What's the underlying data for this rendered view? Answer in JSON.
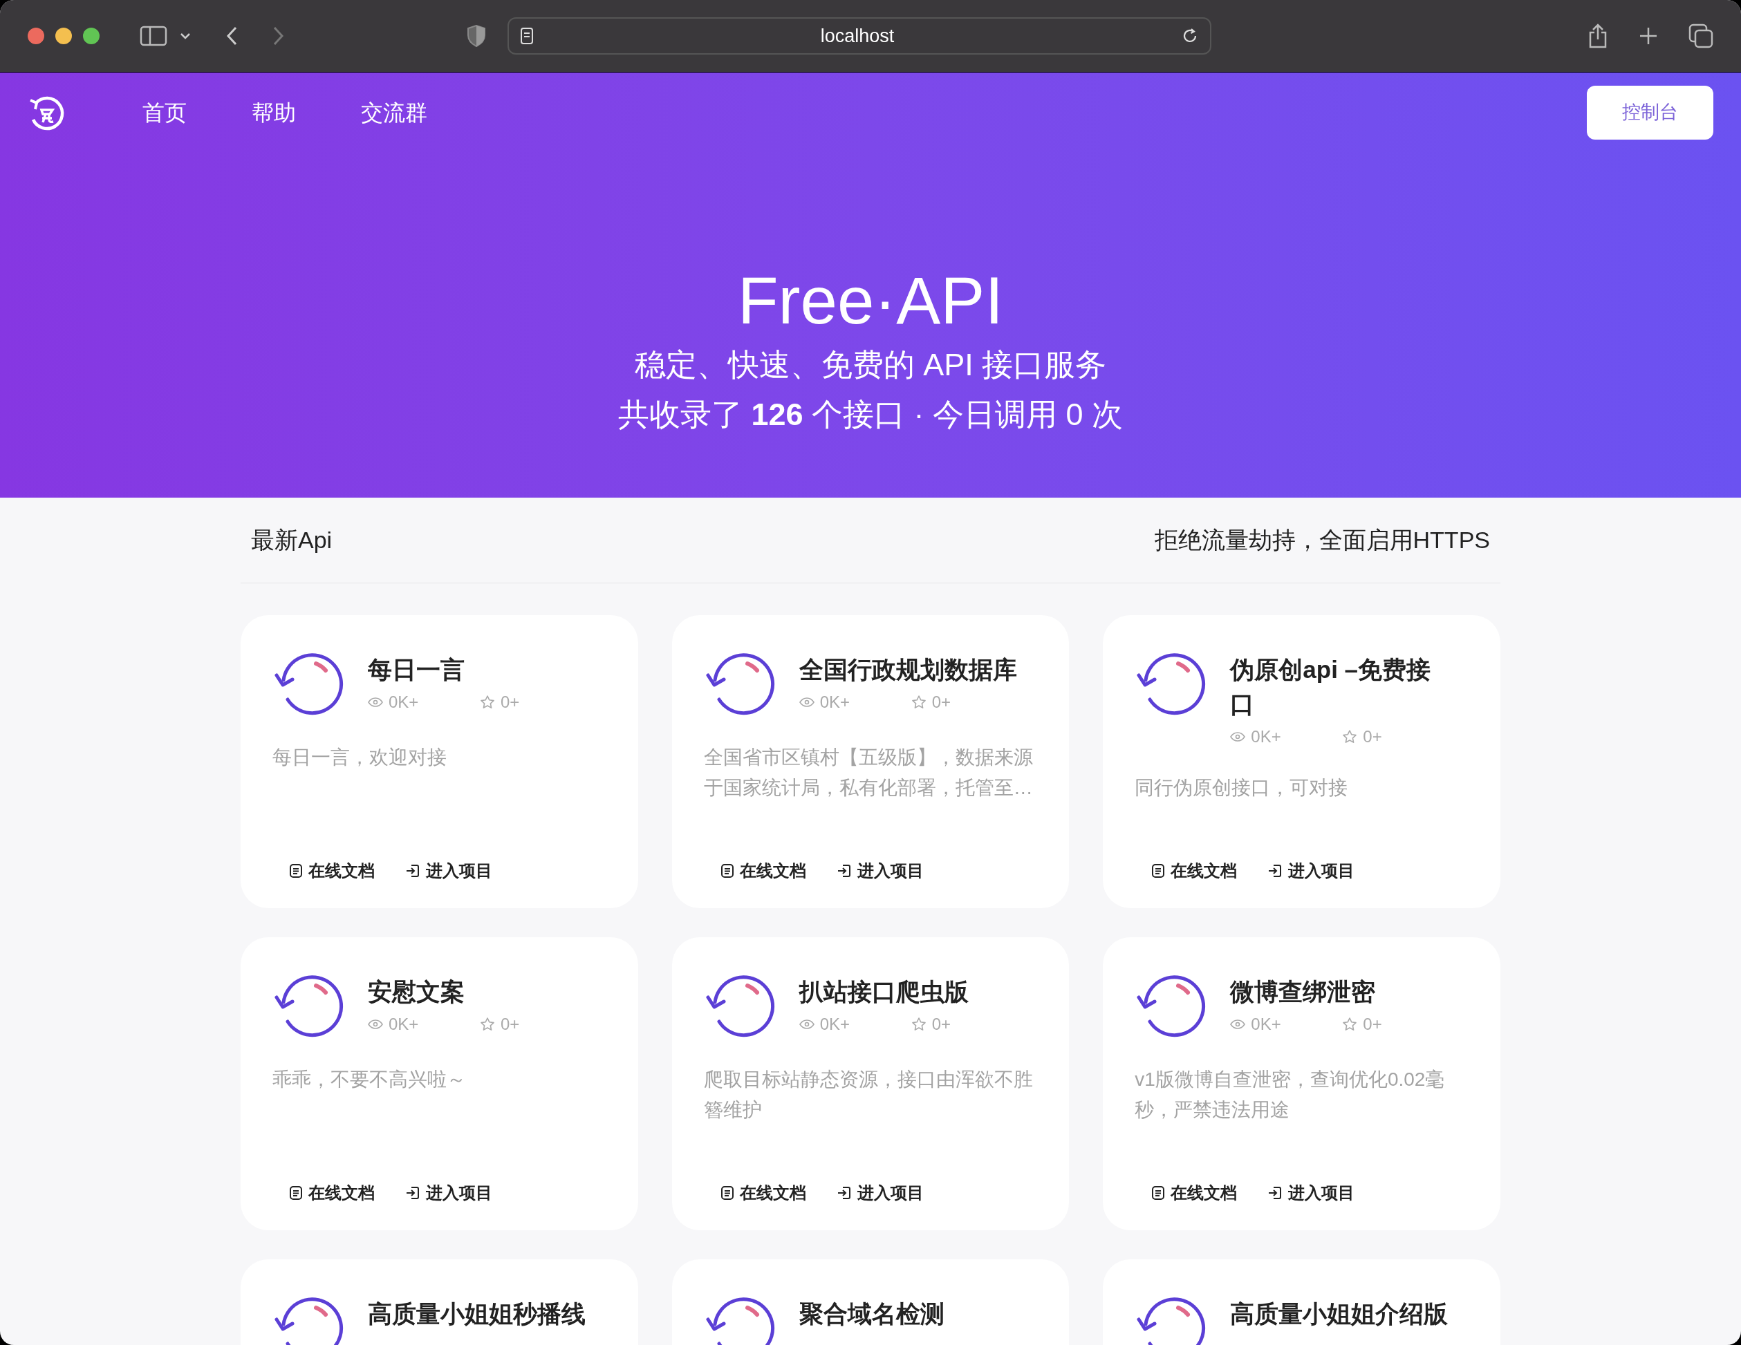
{
  "browser": {
    "url": "localhost"
  },
  "nav": {
    "items": [
      "首页",
      "帮助",
      "交流群"
    ],
    "console_button": "控制台"
  },
  "hero": {
    "title": "Free·API",
    "subtitle": "稳定、快速、免费的 API 接口服务",
    "stats": "共收录了 **126** 个接口 · 今日调用 0 次"
  },
  "section": {
    "title": "最新Api",
    "note": "拒绝流量劫持，全面启用HTTPS"
  },
  "cards": [
    {
      "title": "每日一言",
      "views": "0K+",
      "stars": "0+",
      "description": "每日一言，欢迎对接",
      "actions": [
        "在线文档",
        "进入项目"
      ]
    },
    {
      "title": "全国行政规划数据库",
      "views": "0K+",
      "stars": "0+",
      "description": "全国省市区镇村【五级版】，数据来源于国家统计局，私有化部署，托管至…",
      "actions": [
        "在线文档",
        "进入项目"
      ]
    },
    {
      "title": "伪原创api –免费接口",
      "views": "0K+",
      "stars": "0+",
      "description": "同行伪原创接口，可对接",
      "actions": [
        "在线文档",
        "进入项目"
      ]
    },
    {
      "title": "安慰文案",
      "views": "0K+",
      "stars": "0+",
      "description": "乖乖，不要不高兴啦～",
      "actions": [
        "在线文档",
        "进入项目"
      ]
    },
    {
      "title": "扒站接口爬虫版",
      "views": "0K+",
      "stars": "0+",
      "description": "爬取目标站静态资源，接口由浑欲不胜簪维护",
      "actions": [
        "在线文档",
        "进入项目"
      ]
    },
    {
      "title": "微博查绑泄密",
      "views": "0K+",
      "stars": "0+",
      "description": "v1版微博自查泄密，查询优化0.02毫秒，严禁违法用途",
      "actions": [
        "在线文档",
        "进入项目"
      ]
    },
    {
      "title": "高质量小姐姐秒播线"
    },
    {
      "title": "聚合域名检测"
    },
    {
      "title": "高质量小姐姐介绍版"
    }
  ]
}
